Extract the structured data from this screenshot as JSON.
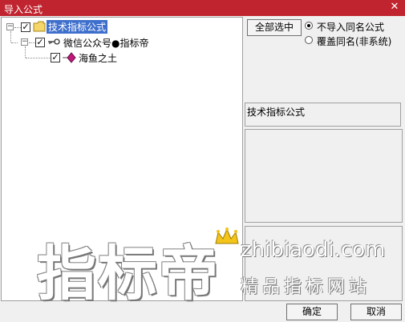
{
  "window": {
    "title": "导入公式",
    "close_glyph": "✕"
  },
  "tree": {
    "root_label": "技术指标公式",
    "child_label": "微信公众号●指标帝",
    "leaf_label": "海鱼之土",
    "expander_glyph": "−",
    "check_glyph": "✓"
  },
  "options": {
    "select_all_label": "全部选中",
    "radio_no_import": "不导入同名公式",
    "radio_overwrite": "覆盖同名(非系统)",
    "selected_radio": "no_import"
  },
  "info": {
    "category_text": "技术指标公式"
  },
  "watermark": {
    "main": "指标帝",
    "url": "zhibiaodi.com",
    "tagline": "精品指标网站"
  },
  "buttons": {
    "ok_label": "确定",
    "cancel_label": "取消"
  },
  "icons": {
    "folder": "folder-icon",
    "key": "key-icon",
    "formula": "formula-icon",
    "crown": "crown-icon"
  },
  "colors": {
    "titlebar": "#c0242f",
    "selection": "#3f6fcc",
    "formula_icon": "#c0187a"
  }
}
